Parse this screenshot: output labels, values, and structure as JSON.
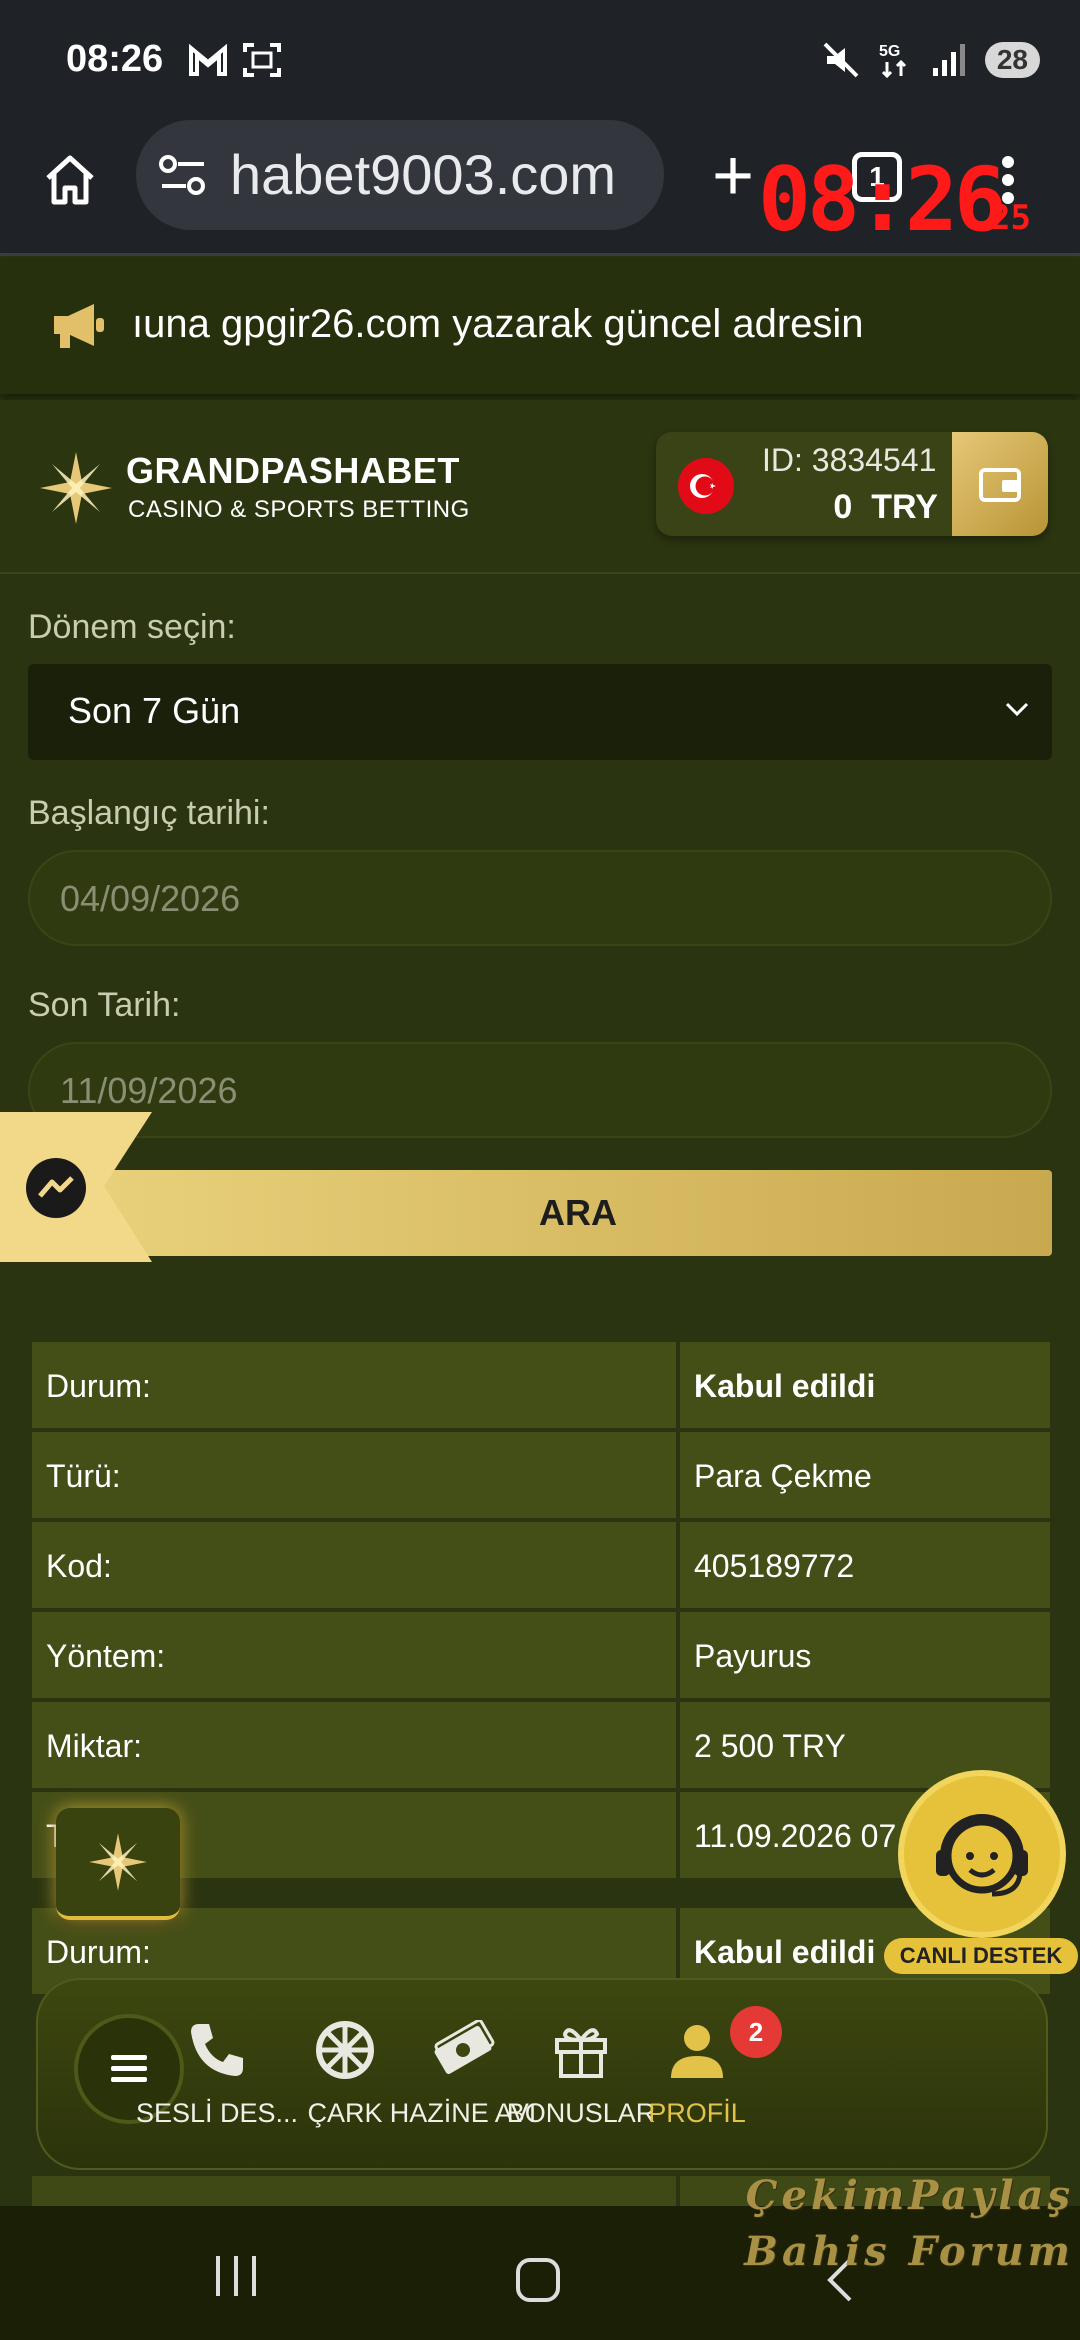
{
  "status_bar": {
    "time": "08:26",
    "battery": "28"
  },
  "browser": {
    "url": "habet9003.com",
    "tab_count": "1",
    "overlay_clock": "08:26",
    "overlay_seconds": "25"
  },
  "announcement": {
    "text": "ıuna gpgir26.com yazarak güncel adresin"
  },
  "header": {
    "brand": "GRANDPASHABET",
    "tagline": "CASINO & SPORTS BETTING",
    "account_id": "ID: 3834541",
    "balance": "0",
    "currency": "TRY"
  },
  "form": {
    "period_label": "Dönem seçin:",
    "period_value": "Son 7 Gün",
    "start_label": "Başlangıç tarihi:",
    "start_value": "04/09/2026",
    "end_label": "Son Tarih:",
    "end_value": "11/09/2026",
    "search_label": "ARA"
  },
  "records": [
    {
      "status_label": "Durum:",
      "status": "Kabul edildi",
      "type_label": "Türü:",
      "type": "Para Çekme",
      "code_label": "Kod:",
      "code": "405189772",
      "method_label": "Yöntem:",
      "method": "Payurus",
      "amount_label": "Miktar:",
      "amount": "2 500 TRY",
      "date_label": "T",
      "date": "11.09.2026 07"
    },
    {
      "status_label": "Durum:",
      "status": "Kabul edildi"
    }
  ],
  "support": {
    "label": "CANLI DESTEK"
  },
  "bottom_nav": {
    "items": [
      {
        "label": "SESLİ DES..."
      },
      {
        "label": "ÇARK"
      },
      {
        "label": "HAZİNE AVI"
      },
      {
        "label": "BONUSLAR"
      },
      {
        "label": "PROFİL",
        "badge": "2"
      }
    ]
  },
  "watermark": {
    "line1": "ÇekimPaylaş",
    "line2": "Bahis Forum"
  },
  "colors": {
    "accent_gold": "#e3c24a",
    "page_bg": "#2a3410",
    "table_cell": "#444e17",
    "badge_red": "#e53935"
  }
}
